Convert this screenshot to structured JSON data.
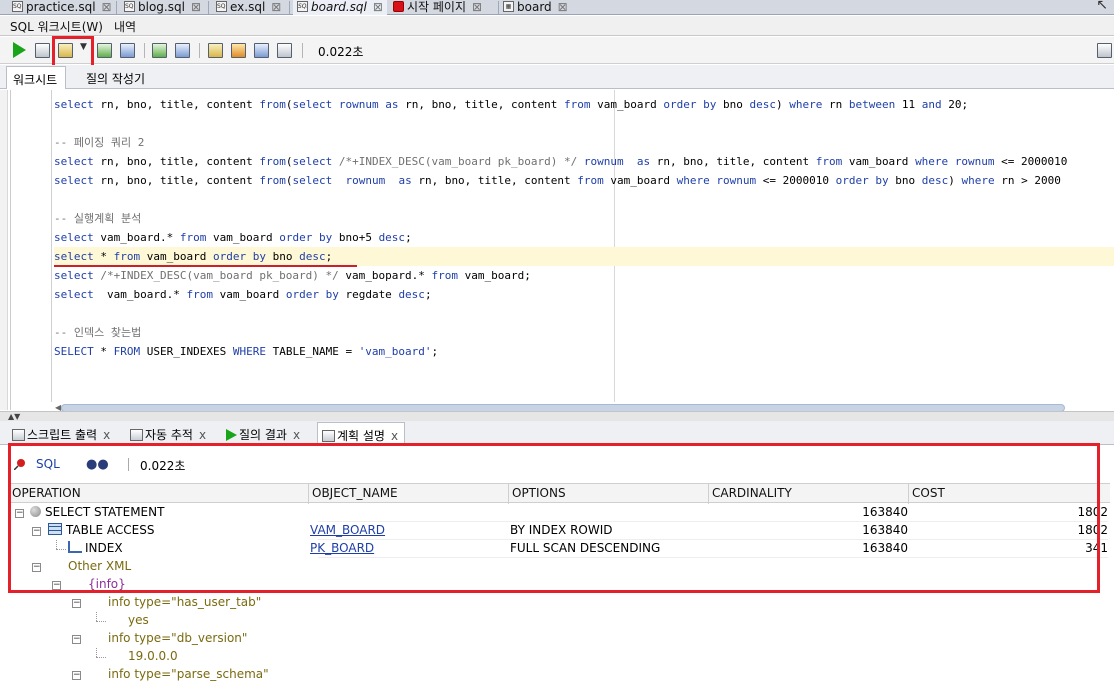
{
  "file_tabs": [
    {
      "label": "practice.sql",
      "icon": "sql-file-icon"
    },
    {
      "label": "blog.sql",
      "icon": "sql-file-icon"
    },
    {
      "label": "ex.sql",
      "icon": "sql-file-icon"
    },
    {
      "label": "board.sql",
      "icon": "sql-file-icon",
      "active": true
    },
    {
      "label": "시작 페이지",
      "icon": "oracle-start-icon"
    },
    {
      "label": "board",
      "icon": "table-icon"
    }
  ],
  "close_glyph": "⊠",
  "worksheet_tabs": {
    "worksheet": "SQL 워크시트(W)",
    "history": "내역"
  },
  "toolbar": {
    "elapsed": "0.022초"
  },
  "editor_subtabs": {
    "worksheet": "워크시트",
    "query_builder": "질의 작성기"
  },
  "code_lines": [
    {
      "text": "select rn, bno, title, content from(select rownum as rn, bno, title, content from vam_board order by bno desc) where rn between 11 and 20;",
      "kind": "code"
    },
    {
      "text": "",
      "kind": "blank"
    },
    {
      "text": "-- 페이징 쿼리 2",
      "kind": "comment"
    },
    {
      "text": "select rn, bno, title, content from(select /*+INDEX_DESC(vam_board pk_board) */ rownum  as rn, bno, title, content from vam_board where rownum <= 2000010",
      "kind": "code"
    },
    {
      "text": "select rn, bno, title, content from(select  rownum  as rn, bno, title, content from vam_board where rownum <= 2000010 order by bno desc) where rn > 2000",
      "kind": "code"
    },
    {
      "text": "",
      "kind": "blank"
    },
    {
      "text": "-- 실행계획 분석",
      "kind": "comment"
    },
    {
      "text": "select vam_board.* from vam_board order by bno+5 desc;",
      "kind": "code"
    },
    {
      "text": "select * from vam_board order by bno desc;",
      "kind": "code",
      "highlight": true
    },
    {
      "text": "select /*+INDEX_DESC(vam_board pk_board) */ vam_bopard.* from vam_board;",
      "kind": "code"
    },
    {
      "text": "select  vam_board.* from vam_board order by regdate desc;",
      "kind": "code"
    },
    {
      "text": "",
      "kind": "blank"
    },
    {
      "text": "-- 인덱스 찾는법",
      "kind": "comment"
    },
    {
      "text": "SELECT * FROM USER_INDEXES WHERE TABLE_NAME = 'vam_board';",
      "kind": "code"
    }
  ],
  "bottom_tabs": [
    {
      "label": "스크립트 출력",
      "icon": "script-output-icon"
    },
    {
      "label": "자동 추적",
      "icon": "autotrace-icon"
    },
    {
      "label": "질의 결과",
      "icon": "query-result-icon"
    },
    {
      "label": "계획 설명",
      "icon": "explain-plan-icon",
      "active": true
    }
  ],
  "tab_close": "x",
  "plan_toolbar": {
    "sql_label": "SQL",
    "elapsed": "0.022초"
  },
  "plan_columns": [
    "OPERATION",
    "OBJECT_NAME",
    "OPTIONS",
    "CARDINALITY",
    "COST"
  ],
  "plan_rows": [
    {
      "operation": "SELECT STATEMENT",
      "object_name": "",
      "options": "",
      "cardinality": "163840",
      "cost": "1802"
    },
    {
      "operation": "TABLE ACCESS",
      "object_name": "VAM_BOARD",
      "options": "BY INDEX ROWID",
      "cardinality": "163840",
      "cost": "1802"
    },
    {
      "operation": "INDEX",
      "object_name": "PK_BOARD",
      "options": "FULL SCAN DESCENDING",
      "cardinality": "163840",
      "cost": "341"
    }
  ],
  "xml_tree": {
    "other_xml": "Other XML",
    "info": "{info}",
    "items": [
      {
        "label": "info type=\"has_user_tab\"",
        "value": "yes"
      },
      {
        "label": "info type=\"db_version\"",
        "value": "19.0.0.0"
      },
      {
        "label": "info type=\"parse_schema\"",
        "value": ""
      }
    ]
  }
}
